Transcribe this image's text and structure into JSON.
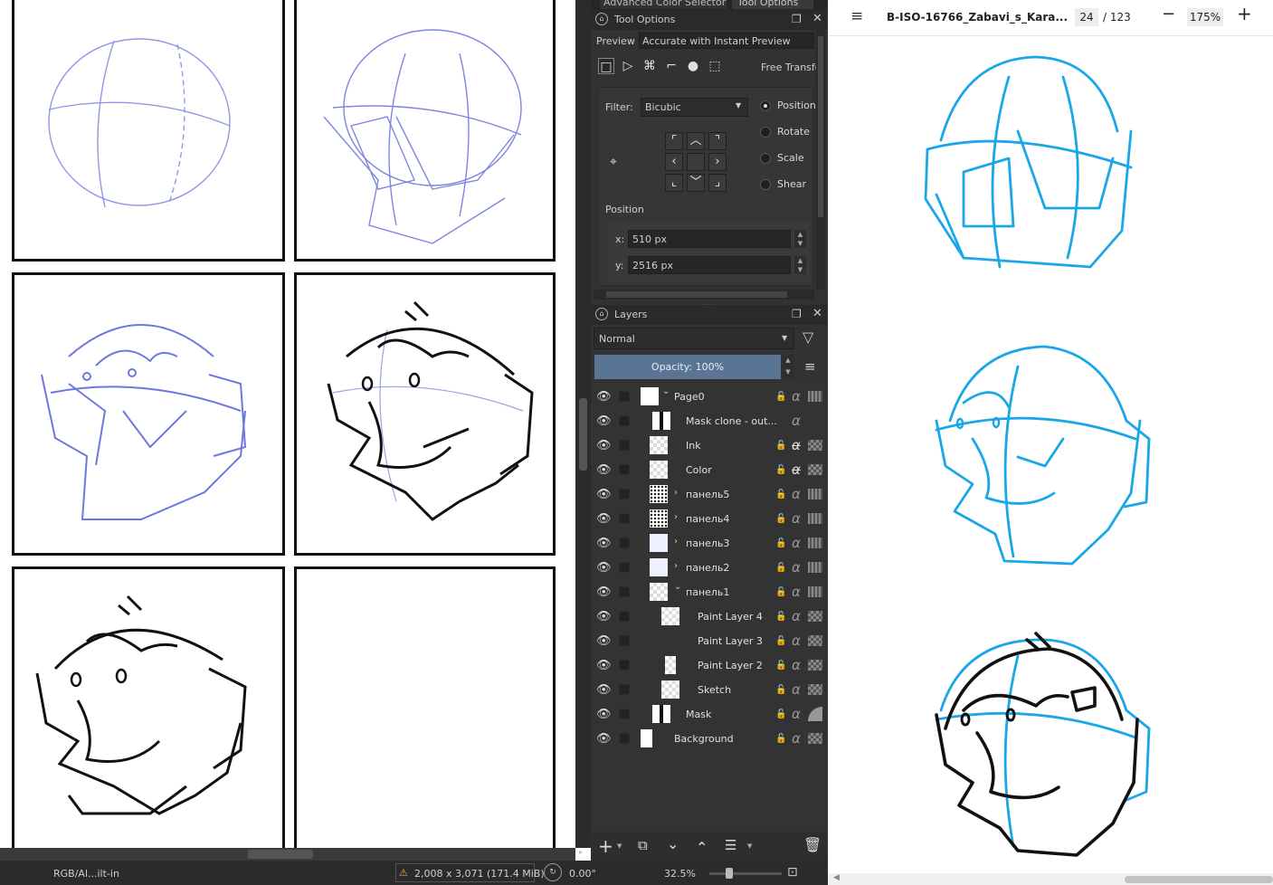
{
  "dock": {
    "tab_advanced_color": "Advanced Color Selector",
    "tab_tool_options": "Tool Options",
    "tool_options_title": "Tool Options",
    "preview_label": "Preview",
    "preview_value": "Accurate with Instant Preview",
    "free_transform_label": "Free Transfo",
    "filter_label": "Filter:",
    "filter_value": "Bicubic",
    "mode_options": [
      "Position",
      "Rotate",
      "Scale",
      "Shear"
    ],
    "mode_selected": "Position",
    "position_label": "Position",
    "x_label": "x:",
    "x_value": "510 px",
    "y_label": "y:",
    "y_value": "2516 px"
  },
  "layers": {
    "title": "Layers",
    "blend_mode": "Normal",
    "opacity_label": "Opacity:  100%",
    "items": [
      {
        "name": "Page0",
        "thumb": "white"
      },
      {
        "name": "Mask clone - out...",
        "thumb": "mask"
      },
      {
        "name": "Ink",
        "thumb": "checker"
      },
      {
        "name": "Color",
        "thumb": "checker"
      },
      {
        "name": "панель5",
        "thumb": "noise"
      },
      {
        "name": "панель4",
        "thumb": "noise"
      },
      {
        "name": "панель3",
        "thumb": "sketch"
      },
      {
        "name": "панель2",
        "thumb": "sketch"
      },
      {
        "name": "панель1",
        "thumb": "checker"
      },
      {
        "name": "Paint Layer 4",
        "thumb": "checker"
      },
      {
        "name": "Paint Layer 3",
        "thumb": "strip"
      },
      {
        "name": "Paint Layer 2",
        "thumb": "checker"
      },
      {
        "name": "Sketch",
        "thumb": "checker"
      },
      {
        "name": "Mask",
        "thumb": "mask"
      },
      {
        "name": "Background",
        "thumb": "white"
      }
    ]
  },
  "status": {
    "color_profile": "RGB/Al...ilt-in",
    "image_size": "2,008 x 3,071 (171.4 MiB)",
    "rotation": "0.00°",
    "zoom": "32.5%"
  },
  "pdf": {
    "filename": "B-ISO-16766_Zabavi_s_Kara...",
    "current_page": "24",
    "total_pages": "/ 123",
    "zoom": "175%",
    "accent_color": "#1aa7e8"
  }
}
